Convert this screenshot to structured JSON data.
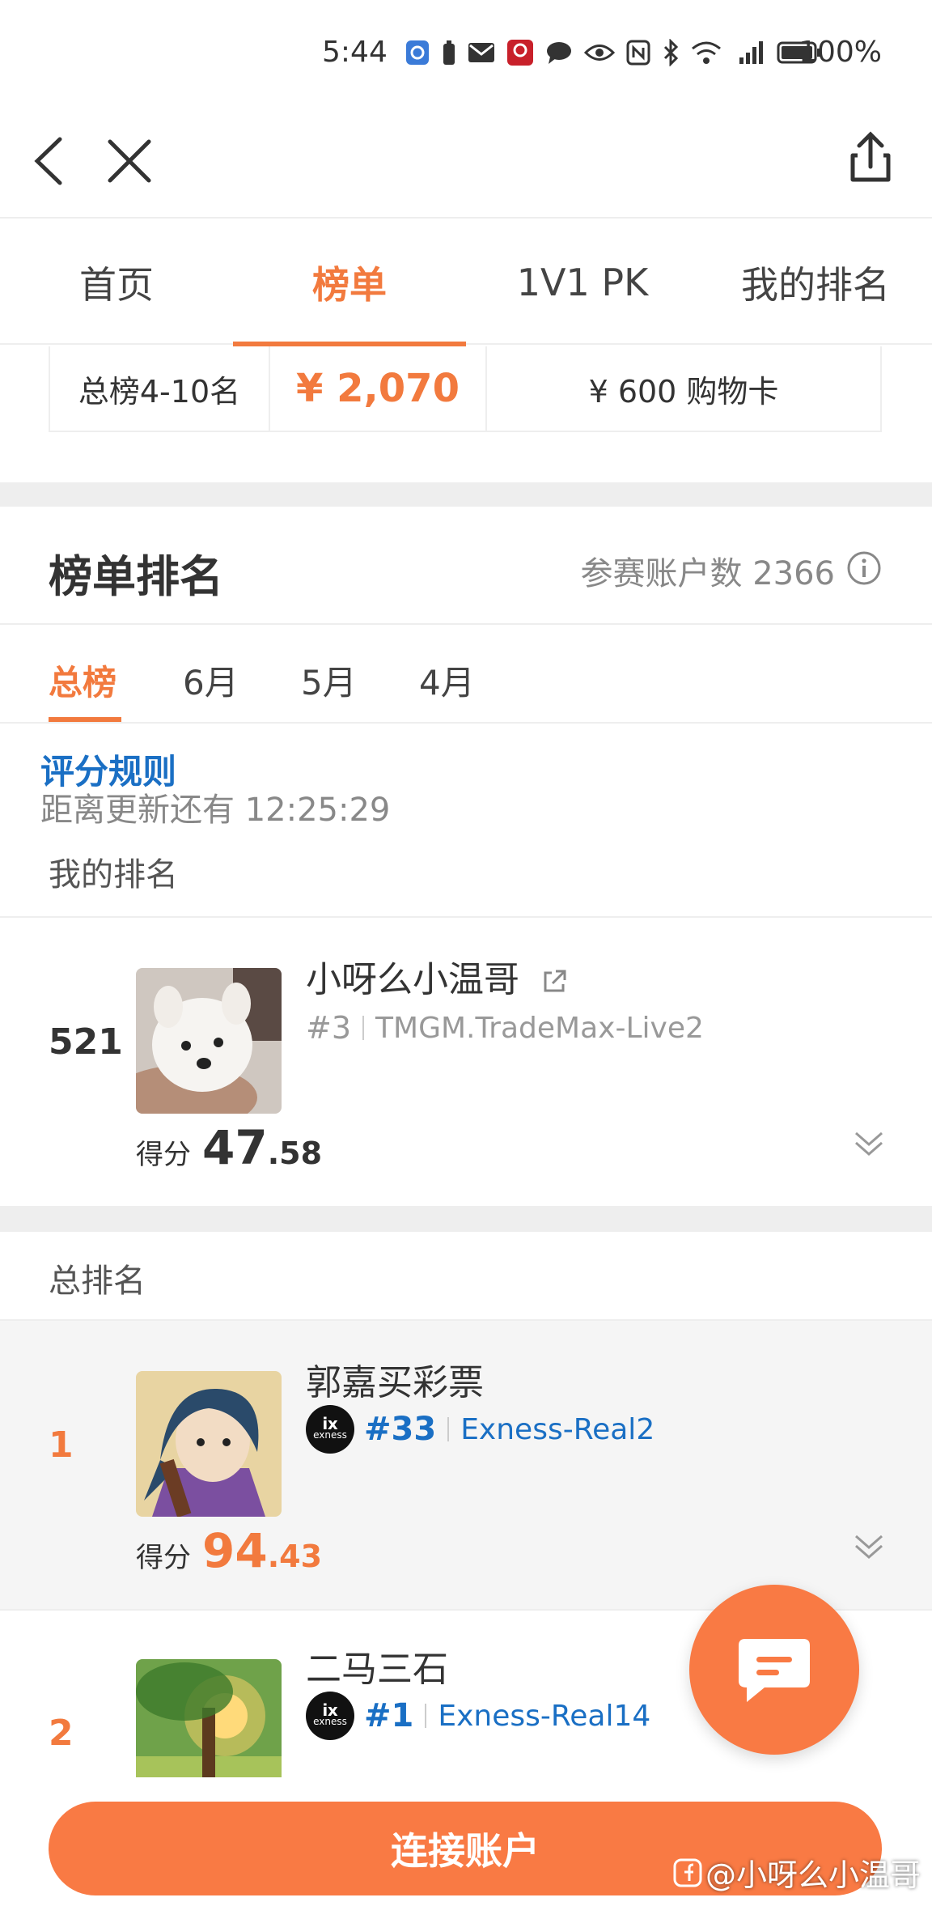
{
  "status_bar": {
    "time": "5:44",
    "battery": "100%"
  },
  "tabs": [
    {
      "label": "首页",
      "active": false
    },
    {
      "label": "榜单",
      "active": true
    },
    {
      "label": "1V1 PK",
      "active": false
    },
    {
      "label": "我的排名",
      "active": false
    }
  ],
  "prize": {
    "rank_range": "总榜4-10名",
    "cash": "¥ 2,070",
    "gift": "¥ 600 购物卡"
  },
  "ranking": {
    "title": "榜单排名",
    "participant_count": "参赛账户数 2366",
    "subtabs": [
      "总榜",
      "6月",
      "5月",
      "4月"
    ],
    "rules_link": "评分规则",
    "countdown": "距离更新还有 12:25:29",
    "my_rank_label": "我的排名",
    "total_label": "总排名"
  },
  "my_entry": {
    "rank": "521",
    "name": "小呀么小温哥",
    "tag": "#3",
    "account": "TMGM.TradeMax-Live2",
    "score_label": "得分",
    "score_int": "47",
    "score_dec": ".58"
  },
  "entries": [
    {
      "rank": "1",
      "name": "郭嘉买彩票",
      "tag": "#33",
      "account": "Exness-Real2",
      "score_label": "得分",
      "score_int": "94",
      "score_dec": ".43",
      "broker_logo": "exness"
    },
    {
      "rank": "2",
      "name": "二马三石",
      "tag": "#1",
      "account": "Exness-Real14",
      "broker_logo": "exness"
    }
  ],
  "bottom": {
    "connect_button": "连接账户",
    "watermark": "@小呀么小温哥"
  },
  "colors": {
    "accent": "#f27a3e",
    "link": "#1a6fc4",
    "fab": "#f97a44"
  }
}
